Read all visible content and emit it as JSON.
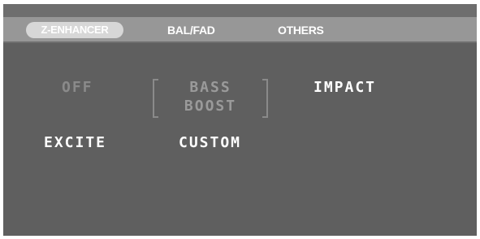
{
  "tabs": [
    {
      "label": "Z-ENHANCER",
      "active": true
    },
    {
      "label": "BAL/FAD",
      "active": false
    },
    {
      "label": "OTHERS",
      "active": false
    }
  ],
  "options": {
    "off": "OFF",
    "bass_boost": {
      "line1": "BASS",
      "line2": "BOOST",
      "selected": true
    },
    "impact": "IMPACT",
    "excite": "EXCITE",
    "custom": "CUSTOM"
  },
  "colors": {
    "screen_bg": "#5f5f5f",
    "tab_strip": "#979797",
    "active_tab_pill": "#d7d7d7",
    "text": "#ffffff",
    "dimmed_text": "#8a8a8a"
  }
}
